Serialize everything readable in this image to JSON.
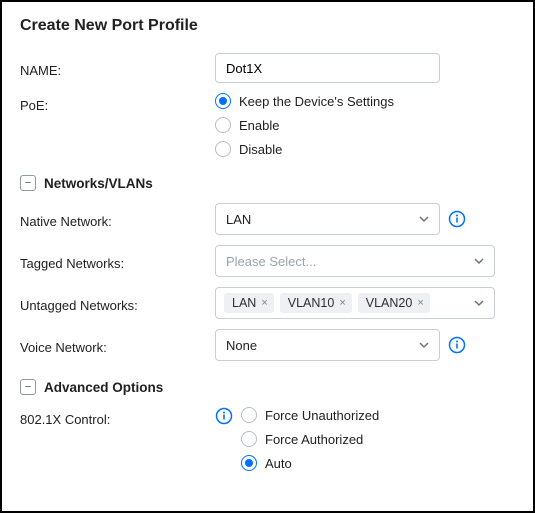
{
  "title": "Create New Port Profile",
  "name_field": {
    "label": "NAME:",
    "value": "Dot1X"
  },
  "poe": {
    "label": "PoE:",
    "options": {
      "keep": "Keep the Device's Settings",
      "enable": "Enable",
      "disable": "Disable"
    },
    "selected": "keep"
  },
  "sections": {
    "networks": {
      "title": "Networks/VLANs",
      "icon": "−"
    },
    "advanced": {
      "title": "Advanced Options",
      "icon": "−"
    }
  },
  "native_network": {
    "label": "Native Network:",
    "value": "LAN"
  },
  "tagged_networks": {
    "label": "Tagged Networks:",
    "placeholder": "Please Select..."
  },
  "untagged_networks": {
    "label": "Untagged Networks:",
    "tags": [
      "LAN",
      "VLAN10",
      "VLAN20"
    ]
  },
  "voice_network": {
    "label": "Voice Network:",
    "value": "None"
  },
  "dot1x": {
    "label": "802.1X Control:",
    "options": {
      "force_unauth": "Force Unauthorized",
      "force_auth": "Force Authorized",
      "auto": "Auto"
    },
    "selected": "auto"
  }
}
